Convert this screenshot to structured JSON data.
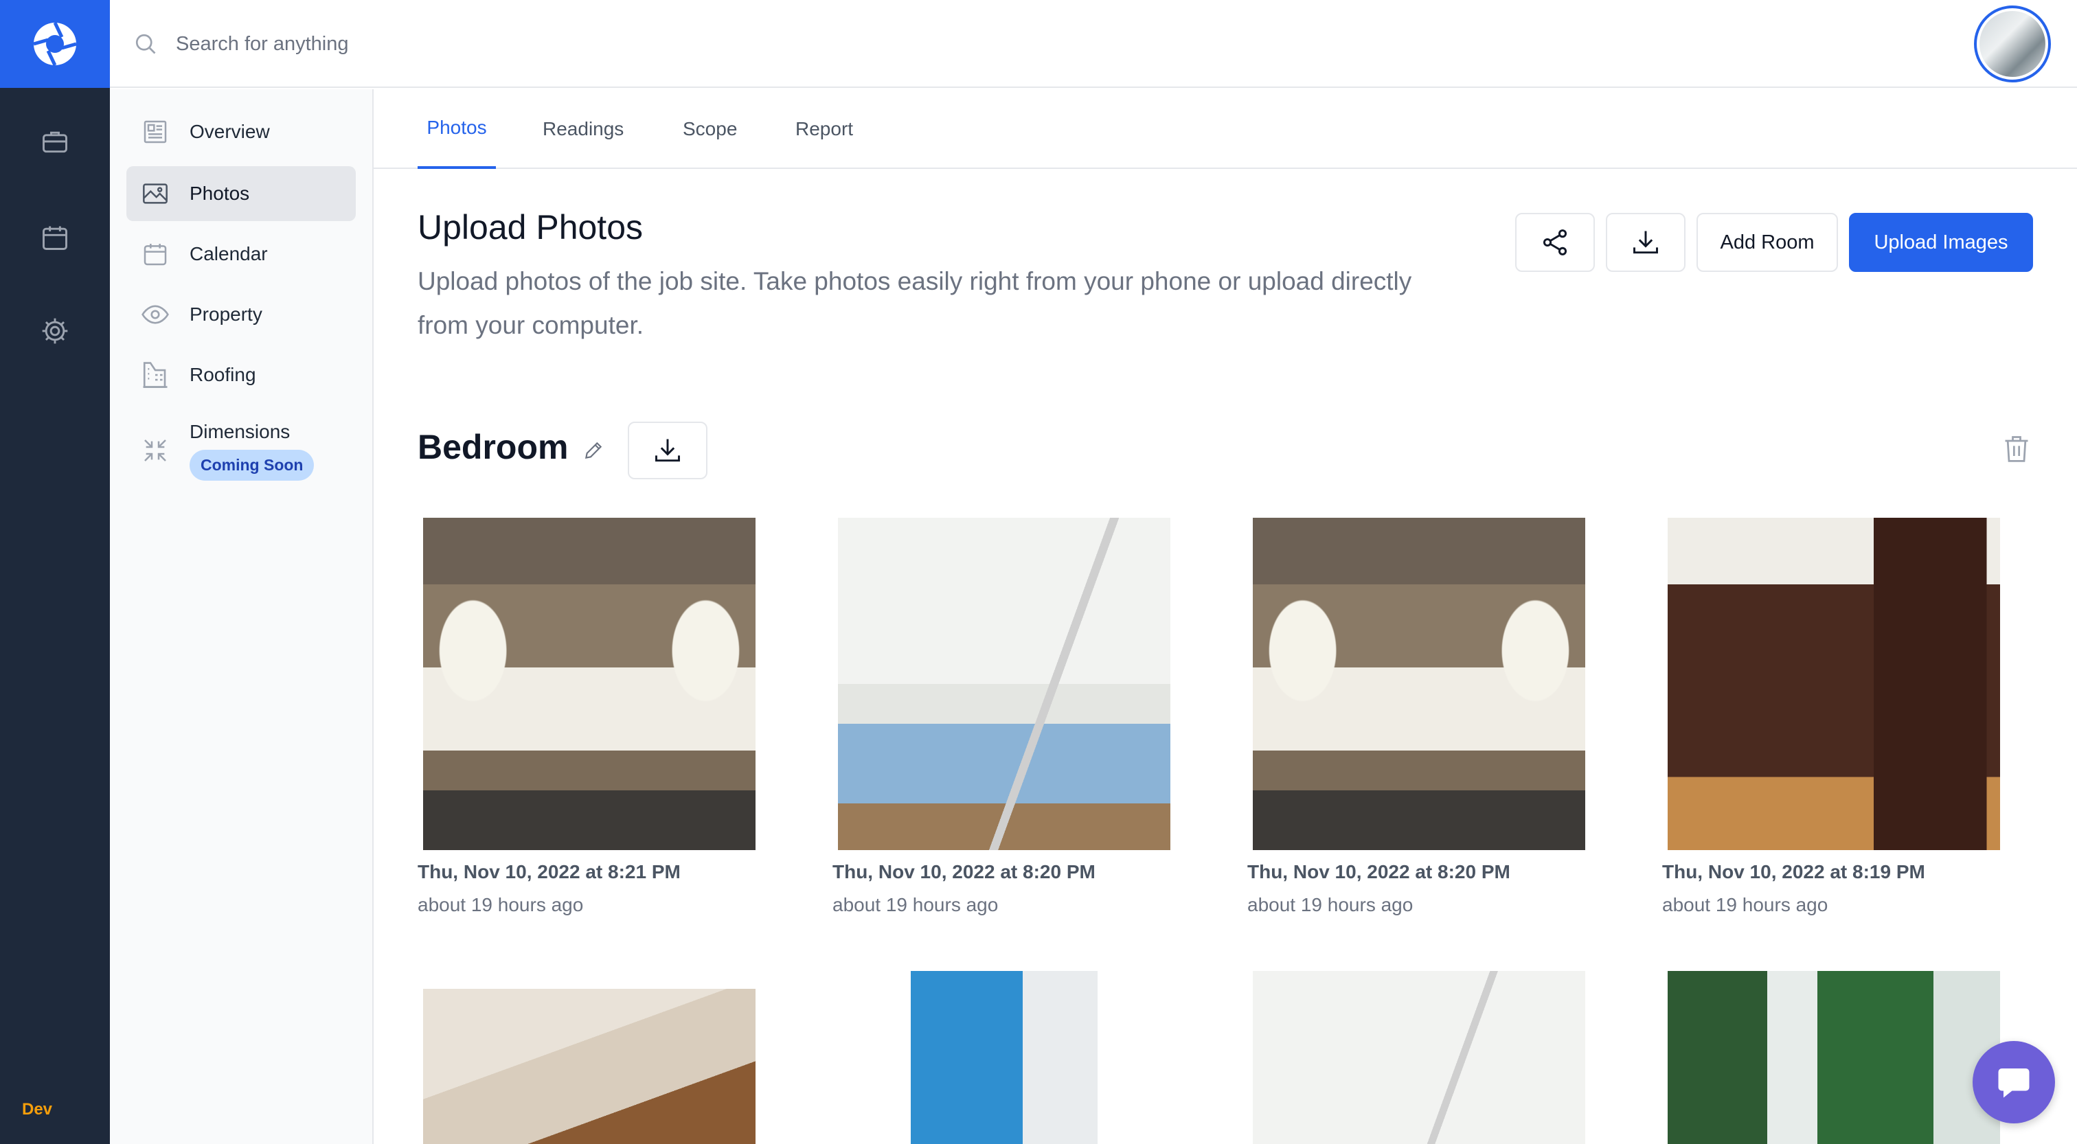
{
  "rail": {
    "items": [
      {
        "icon": "briefcase-icon"
      },
      {
        "icon": "calendar-icon"
      },
      {
        "icon": "gear-icon"
      }
    ],
    "env_label": "Dev"
  },
  "search": {
    "placeholder": "Search for anything",
    "value": ""
  },
  "sidebar": {
    "items": [
      {
        "label": "Overview",
        "icon": "document-icon"
      },
      {
        "label": "Photos",
        "icon": "image-icon",
        "active": true
      },
      {
        "label": "Calendar",
        "icon": "calendar-icon"
      },
      {
        "label": "Property",
        "icon": "eye-icon"
      },
      {
        "label": "Roofing",
        "icon": "building-icon"
      },
      {
        "label": "Dimensions",
        "icon": "compress-icon",
        "badge": "Coming Soon"
      }
    ]
  },
  "tabs": [
    {
      "label": "Photos",
      "active": true
    },
    {
      "label": "Readings"
    },
    {
      "label": "Scope"
    },
    {
      "label": "Report"
    }
  ],
  "header": {
    "title": "Upload Photos",
    "description": "Upload photos of the job site. Take photos easily right from your phone or upload directly from your computer.",
    "add_room_label": "Add Room",
    "upload_label": "Upload Images"
  },
  "room": {
    "name": "Bedroom",
    "photos": [
      {
        "date": "Thu, Nov 10, 2022 at 8:21 PM",
        "ago": "about 19 hours ago"
      },
      {
        "date": "Thu, Nov 10, 2022 at 8:20 PM",
        "ago": "about 19 hours ago"
      },
      {
        "date": "Thu, Nov 10, 2022 at 8:20 PM",
        "ago": "about 19 hours ago"
      },
      {
        "date": "Thu, Nov 10, 2022 at 8:19 PM",
        "ago": "about 19 hours ago"
      }
    ]
  },
  "colors": {
    "brand": "#2563eb",
    "rail": "#1e293b",
    "env": "#f59e0b",
    "badge_bg": "#bfdbfe",
    "chat": "#6d5fd8"
  }
}
